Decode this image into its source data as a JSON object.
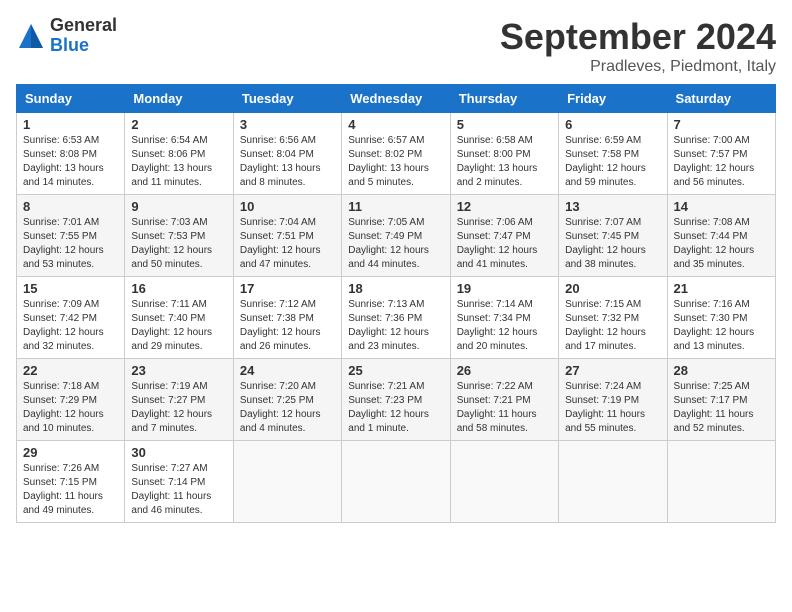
{
  "logo": {
    "general": "General",
    "blue": "Blue"
  },
  "title": "September 2024",
  "location": "Pradleves, Piedmont, Italy",
  "headers": [
    "Sunday",
    "Monday",
    "Tuesday",
    "Wednesday",
    "Thursday",
    "Friday",
    "Saturday"
  ],
  "weeks": [
    [
      {
        "day": "1",
        "sunrise": "6:53 AM",
        "sunset": "8:08 PM",
        "daylight": "13 hours and 14 minutes."
      },
      {
        "day": "2",
        "sunrise": "6:54 AM",
        "sunset": "8:06 PM",
        "daylight": "13 hours and 11 minutes."
      },
      {
        "day": "3",
        "sunrise": "6:56 AM",
        "sunset": "8:04 PM",
        "daylight": "13 hours and 8 minutes."
      },
      {
        "day": "4",
        "sunrise": "6:57 AM",
        "sunset": "8:02 PM",
        "daylight": "13 hours and 5 minutes."
      },
      {
        "day": "5",
        "sunrise": "6:58 AM",
        "sunset": "8:00 PM",
        "daylight": "13 hours and 2 minutes."
      },
      {
        "day": "6",
        "sunrise": "6:59 AM",
        "sunset": "7:58 PM",
        "daylight": "12 hours and 59 minutes."
      },
      {
        "day": "7",
        "sunrise": "7:00 AM",
        "sunset": "7:57 PM",
        "daylight": "12 hours and 56 minutes."
      }
    ],
    [
      {
        "day": "8",
        "sunrise": "7:01 AM",
        "sunset": "7:55 PM",
        "daylight": "12 hours and 53 minutes."
      },
      {
        "day": "9",
        "sunrise": "7:03 AM",
        "sunset": "7:53 PM",
        "daylight": "12 hours and 50 minutes."
      },
      {
        "day": "10",
        "sunrise": "7:04 AM",
        "sunset": "7:51 PM",
        "daylight": "12 hours and 47 minutes."
      },
      {
        "day": "11",
        "sunrise": "7:05 AM",
        "sunset": "7:49 PM",
        "daylight": "12 hours and 44 minutes."
      },
      {
        "day": "12",
        "sunrise": "7:06 AM",
        "sunset": "7:47 PM",
        "daylight": "12 hours and 41 minutes."
      },
      {
        "day": "13",
        "sunrise": "7:07 AM",
        "sunset": "7:45 PM",
        "daylight": "12 hours and 38 minutes."
      },
      {
        "day": "14",
        "sunrise": "7:08 AM",
        "sunset": "7:44 PM",
        "daylight": "12 hours and 35 minutes."
      }
    ],
    [
      {
        "day": "15",
        "sunrise": "7:09 AM",
        "sunset": "7:42 PM",
        "daylight": "12 hours and 32 minutes."
      },
      {
        "day": "16",
        "sunrise": "7:11 AM",
        "sunset": "7:40 PM",
        "daylight": "12 hours and 29 minutes."
      },
      {
        "day": "17",
        "sunrise": "7:12 AM",
        "sunset": "7:38 PM",
        "daylight": "12 hours and 26 minutes."
      },
      {
        "day": "18",
        "sunrise": "7:13 AM",
        "sunset": "7:36 PM",
        "daylight": "12 hours and 23 minutes."
      },
      {
        "day": "19",
        "sunrise": "7:14 AM",
        "sunset": "7:34 PM",
        "daylight": "12 hours and 20 minutes."
      },
      {
        "day": "20",
        "sunrise": "7:15 AM",
        "sunset": "7:32 PM",
        "daylight": "12 hours and 17 minutes."
      },
      {
        "day": "21",
        "sunrise": "7:16 AM",
        "sunset": "7:30 PM",
        "daylight": "12 hours and 13 minutes."
      }
    ],
    [
      {
        "day": "22",
        "sunrise": "7:18 AM",
        "sunset": "7:29 PM",
        "daylight": "12 hours and 10 minutes."
      },
      {
        "day": "23",
        "sunrise": "7:19 AM",
        "sunset": "7:27 PM",
        "daylight": "12 hours and 7 minutes."
      },
      {
        "day": "24",
        "sunrise": "7:20 AM",
        "sunset": "7:25 PM",
        "daylight": "12 hours and 4 minutes."
      },
      {
        "day": "25",
        "sunrise": "7:21 AM",
        "sunset": "7:23 PM",
        "daylight": "12 hours and 1 minute."
      },
      {
        "day": "26",
        "sunrise": "7:22 AM",
        "sunset": "7:21 PM",
        "daylight": "11 hours and 58 minutes."
      },
      {
        "day": "27",
        "sunrise": "7:24 AM",
        "sunset": "7:19 PM",
        "daylight": "11 hours and 55 minutes."
      },
      {
        "day": "28",
        "sunrise": "7:25 AM",
        "sunset": "7:17 PM",
        "daylight": "11 hours and 52 minutes."
      }
    ],
    [
      {
        "day": "29",
        "sunrise": "7:26 AM",
        "sunset": "7:15 PM",
        "daylight": "11 hours and 49 minutes."
      },
      {
        "day": "30",
        "sunrise": "7:27 AM",
        "sunset": "7:14 PM",
        "daylight": "11 hours and 46 minutes."
      },
      null,
      null,
      null,
      null,
      null
    ]
  ]
}
